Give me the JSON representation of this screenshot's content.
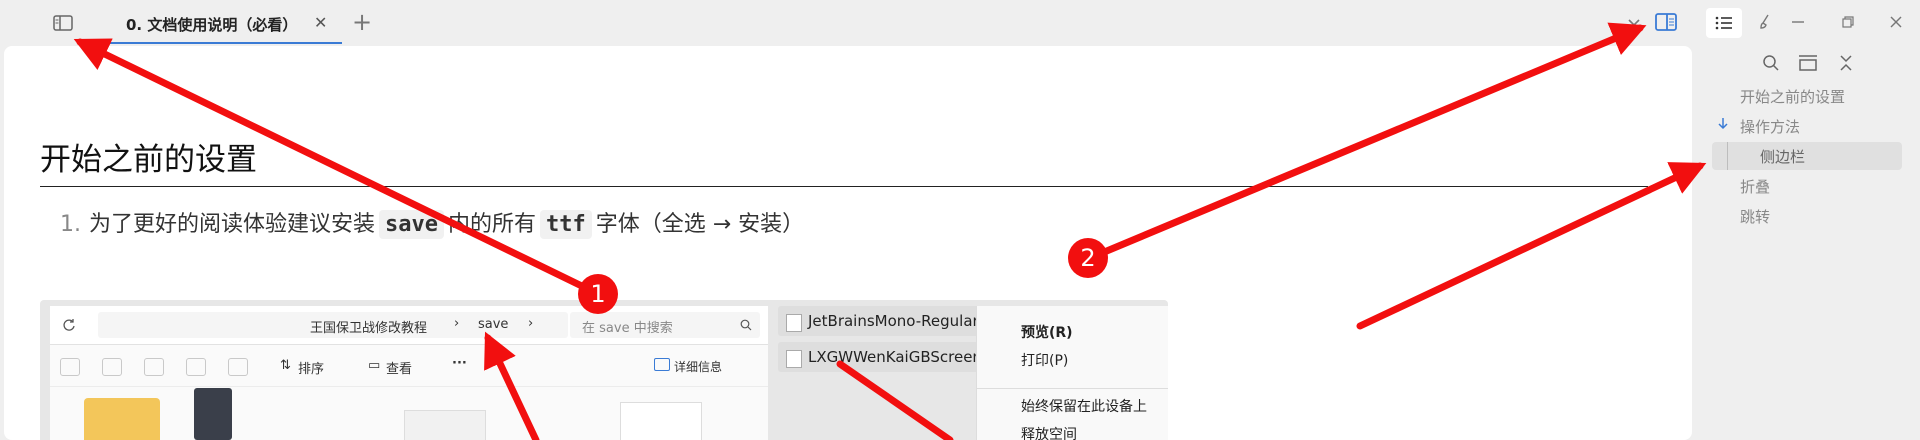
{
  "titlebar": {
    "tab_title": "0. 文档使用说明（必看）",
    "close_tab": "✕",
    "new_tab": "+"
  },
  "document": {
    "heading": "开始之前的设置",
    "list_item": {
      "number": "1.",
      "text_before": "为了更好的阅读体验建议安装",
      "code1": "save",
      "text_middle": "内的所有",
      "code2": "ttf",
      "text_after": "字体（全选 → 安装）"
    }
  },
  "screenshot": {
    "breadcrumb_1": "王国保卫战修改教程",
    "breadcrumb_sep_1": "›",
    "breadcrumb_2": "save",
    "breadcrumb_sep_2": "›",
    "search_placeholder": "在 save 中搜索",
    "toolbar": {
      "sort": "排序",
      "view": "查看",
      "more": "···",
      "details": "详细信息"
    },
    "files": [
      {
        "name": "JetBrainsMono-Regular.ttf"
      },
      {
        "name": "LXGWWenKaiGBScreen.ttf"
      }
    ],
    "context_menu": {
      "preview": "预览(R)",
      "print": "打印(P)",
      "keep_on_device": "始终保留在此设备上",
      "free_space": "释放空间"
    }
  },
  "sidebar": {
    "outline": [
      {
        "label": "开始之前的设置",
        "level": 1
      },
      {
        "label": "操作方法",
        "level": 1,
        "expanded": true
      },
      {
        "label": "侧边栏",
        "level": 2,
        "active": true
      },
      {
        "label": "折叠",
        "level": 1
      },
      {
        "label": "跳转",
        "level": 1
      }
    ]
  },
  "annotations": {
    "badge_1": "1",
    "badge_2": "2",
    "arrow_color": "#f20f0f"
  },
  "colors": {
    "accent": "#3a7bd5",
    "background": "#efefef",
    "panel": "#ffffff"
  }
}
